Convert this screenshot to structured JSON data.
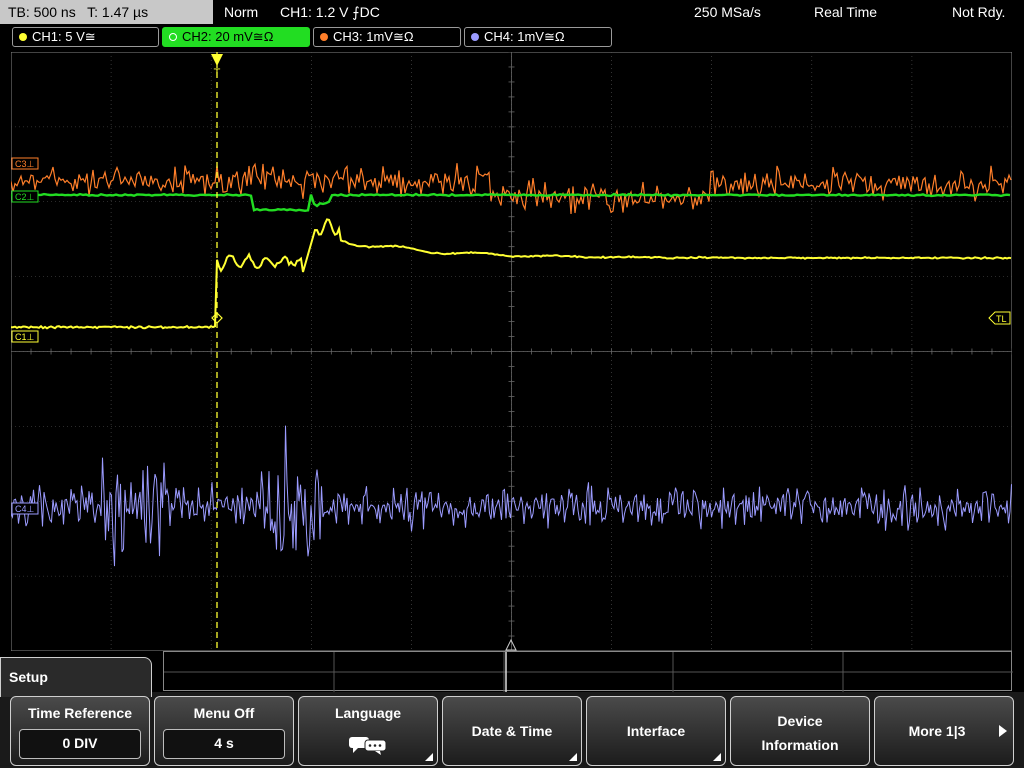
{
  "status": {
    "timebase": "TB: 500 ns",
    "trigger_time": "T: 1.47 µs",
    "mode": "Norm",
    "trigger_setting": "CH1: 1.2 V ⨍DC",
    "sample_rate": "250 MSa/s",
    "acq_mode": "Real Time",
    "ready_state": "Not Rdy."
  },
  "channels": [
    {
      "label": "CH1: 5 V≅",
      "color": "#ffff33"
    },
    {
      "label": "CH2: 20 mV≅Ω",
      "color": "#22dd22",
      "active": true
    },
    {
      "label": "CH3: 1mV≅Ω",
      "color": "#ff7f2a"
    },
    {
      "label": "CH4: 1mV≅Ω",
      "color": "#9b9bff"
    }
  ],
  "screen": {
    "markers": {
      "c3": "C3⊥",
      "c2": "C2⊥",
      "c1": "C1⊥",
      "c4": "C4⊥",
      "trigger_level": "TL",
      "trigger_pos": "T"
    },
    "colors": {
      "ch1": "#ffff33",
      "ch2": "#22dd22",
      "ch3": "#ff7f2a",
      "ch4": "#9b9bff",
      "grid": "#555555"
    }
  },
  "menu": {
    "title": "Setup",
    "buttons": {
      "time_reference_label": "Time Reference",
      "time_reference_value": "0 DIV",
      "menu_off_label": "Menu Off",
      "menu_off_value": "4 s",
      "language_label": "Language",
      "date_time_label": "Date & Time",
      "interface_label": "Interface",
      "device_info_line1": "Device",
      "device_info_line2": "Information",
      "more_label": "More 1|3"
    }
  }
}
